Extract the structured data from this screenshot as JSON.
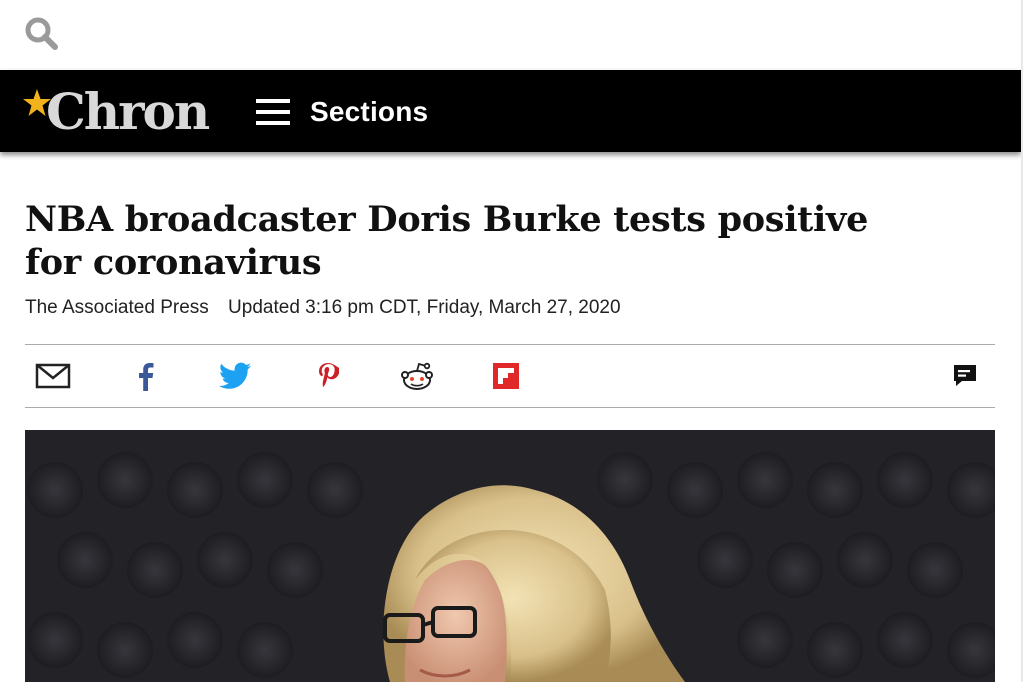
{
  "header": {
    "search_icon": "search-icon",
    "logo_text": "Chron",
    "logo_star_color": "#f2b21c",
    "sections_label": "Sections"
  },
  "article": {
    "headline": "NBA broadcaster Doris Burke tests positive for coronavirus",
    "author": "The Associated Press",
    "updated": "Updated 3:16 pm CDT, Friday, March 27, 2020"
  },
  "share": {
    "items": [
      {
        "name": "email",
        "icon": "email-icon",
        "color": "#222222"
      },
      {
        "name": "facebook",
        "icon": "facebook-icon",
        "color": "#3b5998"
      },
      {
        "name": "twitter",
        "icon": "twitter-icon",
        "color": "#1da1f2"
      },
      {
        "name": "pinterest",
        "icon": "pinterest-icon",
        "color": "#cb2027"
      },
      {
        "name": "reddit",
        "icon": "reddit-icon",
        "color": "#222222"
      },
      {
        "name": "flipboard",
        "icon": "flipboard-icon",
        "color": "#e12828"
      },
      {
        "name": "comments",
        "icon": "comment-icon",
        "color": "#111111"
      }
    ]
  },
  "hero": {
    "image_icon": "photo-woman-blonde-glasses"
  }
}
